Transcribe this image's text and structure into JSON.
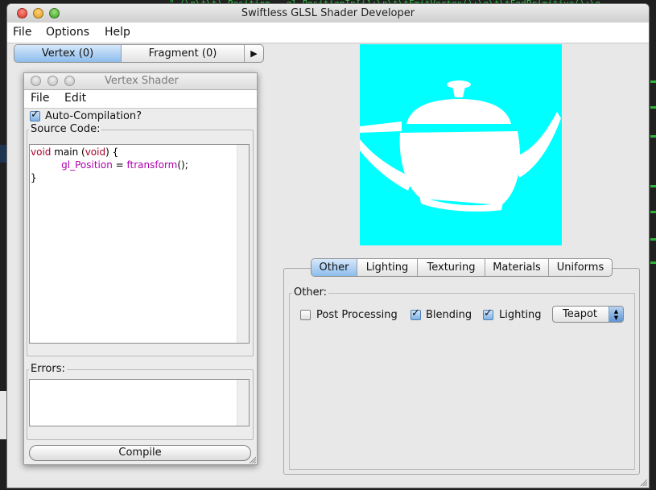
{
  "window": {
    "title": "Swiftless GLSL Shader Developer"
  },
  "background": {
    "code_fragment": "\" (\\n\\t\\t) Position - gl_PositionIn[i];\\n\\t\\tEmitVertex();\\n\\t\\tEndPrimitive();\\n"
  },
  "menubar": {
    "items": [
      "File",
      "Options",
      "Help"
    ]
  },
  "shader_tabs": {
    "items": [
      "Vertex (0)",
      "Fragment (0)"
    ],
    "selected": 0,
    "more_arrow": "▶"
  },
  "vertex_window": {
    "title": "Vertex Shader",
    "menu": [
      "File",
      "Edit"
    ],
    "auto_compilation": {
      "label": "Auto-Compilation?",
      "checked": true
    },
    "source_label": "Source Code:",
    "code": {
      "l1_kw": "void",
      "l1_a": " main (",
      "l1_kw2": "void",
      "l1_b": ") {",
      "l2_indent": "          ",
      "l2_fn": "gl_Position",
      "l2_a": " = ",
      "l2_fn2": "ftransform",
      "l2_b": "();",
      "l3": "}"
    },
    "errors_label": "Errors:",
    "compile_button": "Compile"
  },
  "preview": {
    "background_color": "#00ffff",
    "object_color": "#ffffff"
  },
  "settings_tabs": {
    "items": [
      "Other",
      "Lighting",
      "Texturing",
      "Materials",
      "Uniforms"
    ],
    "selected": 0
  },
  "other_panel": {
    "group_label": "Other:",
    "options": [
      {
        "label": "Post Processing",
        "checked": false
      },
      {
        "label": "Blending",
        "checked": true
      },
      {
        "label": "Lighting",
        "checked": true
      }
    ],
    "model_select": {
      "value": "Teapot"
    }
  },
  "colors": {
    "keyword": "#a8002b",
    "function": "#b000b0",
    "accent": "#8dbdec"
  }
}
